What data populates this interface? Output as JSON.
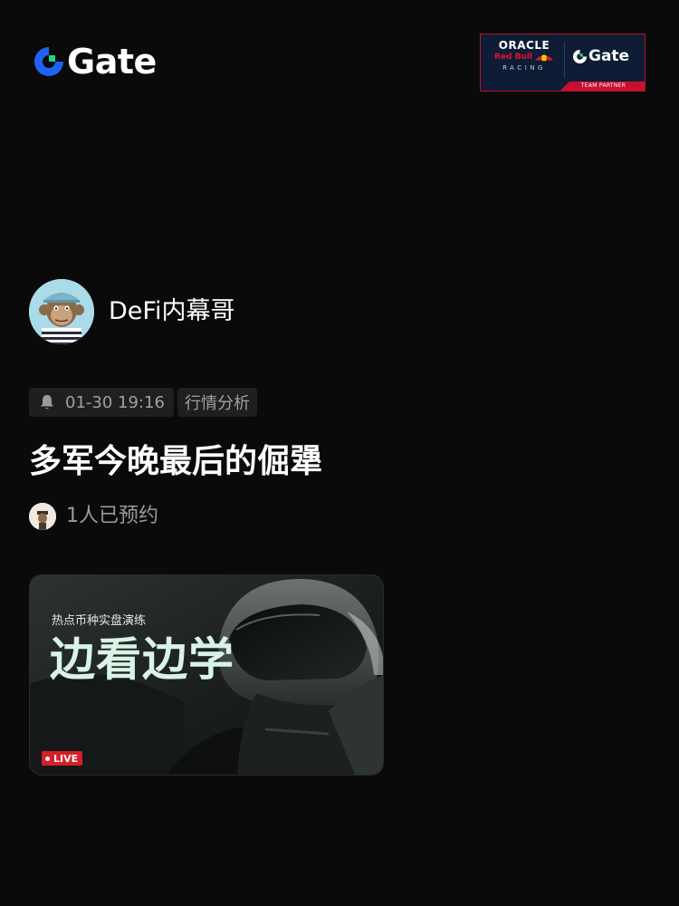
{
  "brand": {
    "logo_text": "Gate",
    "accent_blue": "#1e63f5",
    "accent_green": "#20d28a"
  },
  "partner_badge": {
    "oracle": "ORACLE",
    "redbull": "Red Bull",
    "racing": "RACING",
    "gate": "Gate",
    "team_partner": "TEAM PARTNER"
  },
  "author": {
    "name": "DeFi内幕哥",
    "avatar_icon": "bored-ape-avatar"
  },
  "meta": {
    "time_icon": "bell-icon",
    "time": "01-30 19:16",
    "tag": "行情分析"
  },
  "post": {
    "title": "多军今晚最后的倔犟"
  },
  "booking": {
    "text": "1人已预约"
  },
  "live_card": {
    "subtitle": "热点币种实盘演练",
    "headline": "边看边学",
    "badge": "LIVE",
    "badge_color": "#d81e27"
  }
}
